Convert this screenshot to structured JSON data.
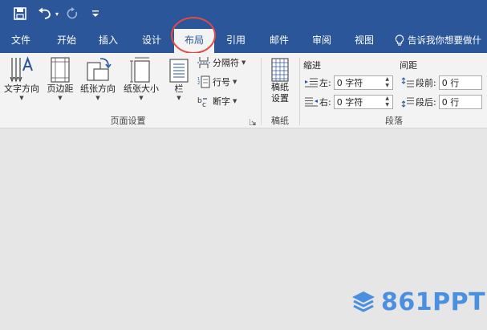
{
  "quick_access": {
    "save_icon": "save-icon",
    "undo_icon": "undo-icon",
    "redo_icon": "redo-icon",
    "customize_icon": "customize-quick-access-icon"
  },
  "tabs": [
    {
      "label": "文件",
      "active": false
    },
    {
      "label": "开始",
      "active": false
    },
    {
      "label": "插入",
      "active": false
    },
    {
      "label": "设计",
      "active": false
    },
    {
      "label": "布局",
      "active": true
    },
    {
      "label": "引用",
      "active": false
    },
    {
      "label": "邮件",
      "active": false
    },
    {
      "label": "审阅",
      "active": false
    },
    {
      "label": "视图",
      "active": false
    }
  ],
  "tell_me": "告诉我你想要做什",
  "ribbon": {
    "page_setup": {
      "text_direction": "文字方向",
      "margins": "页边距",
      "orientation": "纸张方向",
      "size": "纸张大小",
      "columns": "栏",
      "breaks": "分隔符",
      "line_numbers": "行号",
      "hyphenation": "断字",
      "group_label": "页面设置"
    },
    "manuscript": {
      "button_line1": "稿纸",
      "button_line2": "设置",
      "group_label": "稿纸"
    },
    "paragraph": {
      "indent_header": "缩进",
      "spacing_header": "间距",
      "indent_left_label": "左:",
      "indent_left_value": "0 字符",
      "indent_right_label": "右:",
      "indent_right_value": "0 字符",
      "spacing_before_label": "段前:",
      "spacing_before_value": "0 行",
      "spacing_after_label": "段后:",
      "spacing_after_value": "0 行",
      "group_label": "段落"
    }
  },
  "watermark": "861PPT",
  "colors": {
    "title_bar": "#2b579a",
    "ribbon_bg": "#f3f3f3",
    "highlight_ring": "#e24a44",
    "watermark": "#4a8fe0"
  }
}
